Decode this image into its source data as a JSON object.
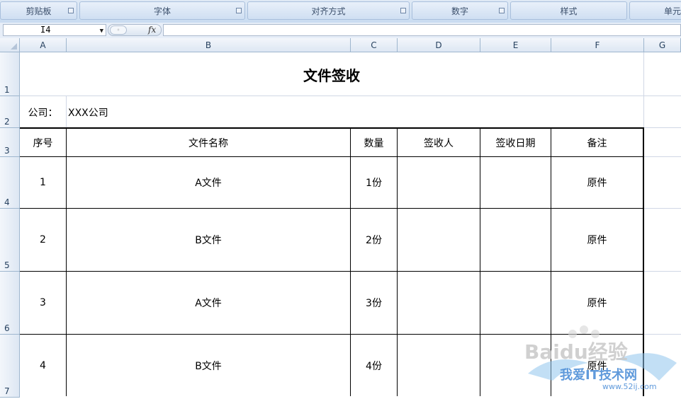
{
  "ribbon": {
    "groups": [
      "剪贴板",
      "字体",
      "对齐方式",
      "数字",
      "样式",
      "单元"
    ]
  },
  "formula_bar": {
    "name_box": "I4",
    "fx_label": "fx",
    "formula": ""
  },
  "grid": {
    "columns": [
      "A",
      "B",
      "C",
      "D",
      "E",
      "F",
      "G"
    ],
    "rows": [
      "1",
      "2",
      "3",
      "4",
      "5",
      "6",
      "7"
    ]
  },
  "sheet": {
    "title": "文件签收",
    "company_label": "公司：",
    "company_value": "XXX公司",
    "headers": [
      "序号",
      "文件名称",
      "数量",
      "签收人",
      "签收日期",
      "备注"
    ],
    "records": [
      {
        "no": "1",
        "name": "A文件",
        "qty": "1份",
        "signer": "",
        "date": "",
        "note": "原件"
      },
      {
        "no": "2",
        "name": "B文件",
        "qty": "2份",
        "signer": "",
        "date": "",
        "note": "原件"
      },
      {
        "no": "3",
        "name": "A文件",
        "qty": "3份",
        "signer": "",
        "date": "",
        "note": "原件"
      },
      {
        "no": "4",
        "name": "B文件",
        "qty": "4份",
        "signer": "",
        "date": "",
        "note": "原件"
      }
    ]
  },
  "watermark": {
    "brand": "Baidu经验",
    "site_name": "我爱IT技术网",
    "site_url": "www.52ij.com"
  }
}
